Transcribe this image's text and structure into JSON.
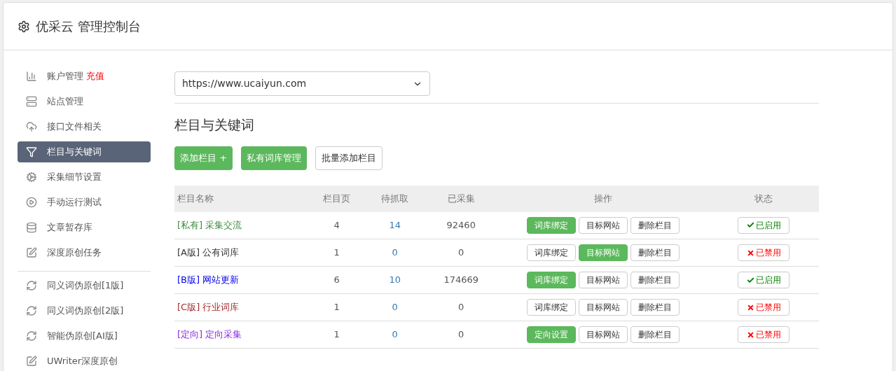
{
  "header": {
    "title": "优采云 管理控制台"
  },
  "sidebar": {
    "items": [
      {
        "kind": "chart",
        "label": "账户管理",
        "link": "充值",
        "selected": false
      },
      {
        "kind": "server",
        "label": "站点管理",
        "selected": false
      },
      {
        "kind": "cloud",
        "label": "接口文件相关",
        "selected": false
      },
      {
        "kind": "filter",
        "label": "栏目与关键词",
        "selected": true
      },
      {
        "kind": "gears",
        "label": "采集细节设置",
        "selected": false
      },
      {
        "kind": "play",
        "label": "手动运行测试",
        "selected": false
      },
      {
        "kind": "database",
        "label": "文章暂存库",
        "selected": false
      },
      {
        "kind": "edit",
        "label": "深度原创任务",
        "selected": false
      },
      {
        "kind": "divider"
      },
      {
        "kind": "refresh",
        "label": "同义词伪原创[1版]",
        "selected": false
      },
      {
        "kind": "refresh",
        "label": "同义词伪原创[2版]",
        "selected": false
      },
      {
        "kind": "refresh",
        "label": "智能伪原创[AI版]",
        "selected": false
      },
      {
        "kind": "edit",
        "label": "UWriter深度原创",
        "selected": false
      }
    ]
  },
  "site_select": {
    "value": "https://www.ucaiyun.com"
  },
  "section_title": "栏目与关键词",
  "toolbar": [
    {
      "label": "添加栏目 +",
      "primary": true
    },
    {
      "label": "私有词库管理",
      "primary": true
    },
    {
      "label": "批量添加栏目",
      "primary": false
    }
  ],
  "table": {
    "columns": [
      "栏目名称",
      "栏目页",
      "待抓取",
      "已采集",
      "操作",
      "状态"
    ],
    "rows": [
      {
        "tag": "[私有]",
        "name": "采集交流",
        "color": "#3c8b3c",
        "column_2": "4",
        "column_3": "14",
        "column_4": "92460",
        "actions": [
          {
            "label": "词库绑定",
            "primary": true
          },
          {
            "label": "目标网站",
            "primary": false
          },
          {
            "label": "删除栏目",
            "primary": false
          }
        ],
        "status": "已启用",
        "enabled": true
      },
      {
        "tag": "[A版]",
        "name": "公有词库",
        "color": "#333333",
        "column_2": "1",
        "column_3": "0",
        "column_4": "0",
        "actions": [
          {
            "label": "词库绑定",
            "primary": false
          },
          {
            "label": "目标网站",
            "primary": true
          },
          {
            "label": "删除栏目",
            "primary": false
          }
        ],
        "status": "已禁用",
        "enabled": false
      },
      {
        "tag": "[B版]",
        "name": "网站更新",
        "color": "#0000ee",
        "column_2": "6",
        "column_3": "10",
        "column_4": "174669",
        "actions": [
          {
            "label": "词库绑定",
            "primary": true
          },
          {
            "label": "目标网站",
            "primary": false
          },
          {
            "label": "删除栏目",
            "primary": false
          }
        ],
        "status": "已启用",
        "enabled": true
      },
      {
        "tag": "[C版]",
        "name": "行业词库",
        "color": "#a52a2a",
        "column_2": "1",
        "column_3": "0",
        "column_4": "0",
        "actions": [
          {
            "label": "词库绑定",
            "primary": false
          },
          {
            "label": "目标网站",
            "primary": false
          },
          {
            "label": "删除栏目",
            "primary": false
          }
        ],
        "status": "已禁用",
        "enabled": false
      },
      {
        "tag": "[定向]",
        "name": "定向采集",
        "color": "#8a2be2",
        "column_2": "1",
        "column_3": "0",
        "column_4": "0",
        "actions": [
          {
            "label": "定向设置",
            "primary": true
          },
          {
            "label": "目标网站",
            "primary": false
          },
          {
            "label": "删除栏目",
            "primary": false
          }
        ],
        "status": "已禁用",
        "enabled": false
      }
    ]
  }
}
